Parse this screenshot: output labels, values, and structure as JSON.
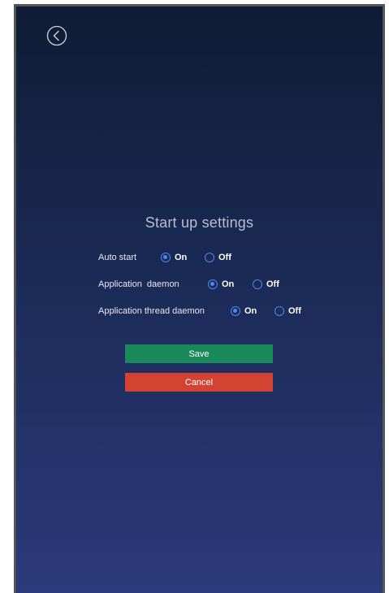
{
  "page": {
    "title": "Start up settings"
  },
  "settings": [
    {
      "label": "Auto start",
      "on_label": "On",
      "off_label": "Off",
      "selected": "on"
    },
    {
      "label": "Application  daemon",
      "on_label": "On",
      "off_label": "Off",
      "selected": "on"
    },
    {
      "label": "Application thread daemon",
      "on_label": "On",
      "off_label": "Off",
      "selected": "on"
    }
  ],
  "buttons": {
    "save_label": "Save",
    "cancel_label": "Cancel"
  },
  "icons": {
    "back": "chevron-left-circle-icon",
    "radio": "radio-button-icon"
  },
  "colors": {
    "accent": "#4a8bf0",
    "save": "#1a8a5a",
    "cancel": "#d34332"
  }
}
